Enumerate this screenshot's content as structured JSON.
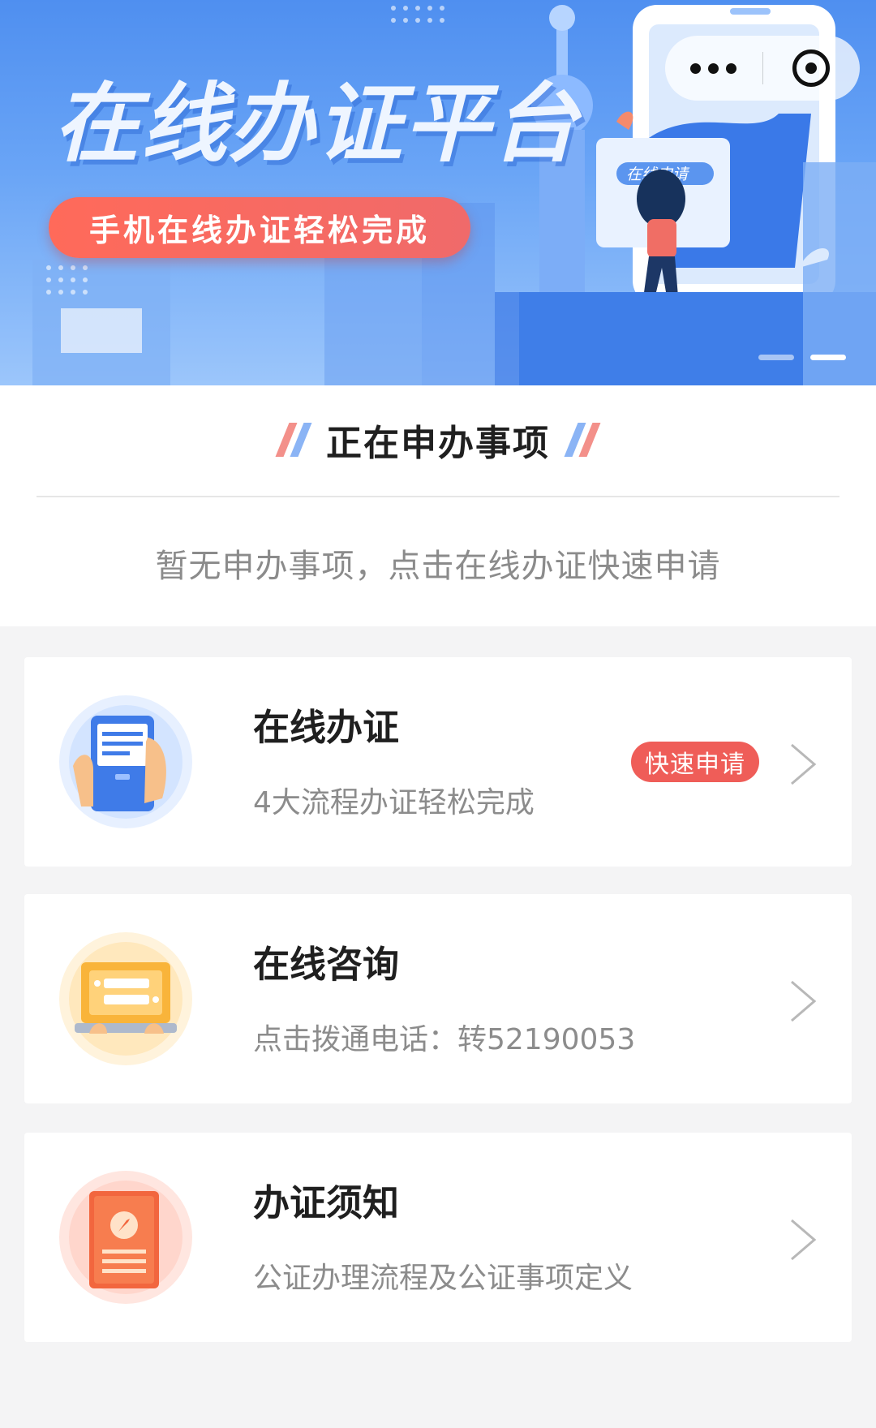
{
  "banner": {
    "title": "在线办证平台",
    "slogan": "手机在线办证轻松完成",
    "illustration_label": "在线申请",
    "carousel": {
      "count": 2,
      "active": 2
    },
    "capsule": {
      "more_icon": "more-dots-icon",
      "close_icon": "target-close-icon"
    }
  },
  "current": {
    "title": "正在申办事项",
    "empty_message": "暂无申办事项，点击在线办证快速申请"
  },
  "cards": [
    {
      "title": "在线办证",
      "subtitle": "4大流程办证轻松完成",
      "badge": "快速申请",
      "icon": "phone-hand-icon"
    },
    {
      "title": "在线咨询",
      "subtitle": "点击拨通电话：转52190053",
      "icon": "laptop-chat-icon"
    },
    {
      "title": "办证须知",
      "subtitle": "公证办理流程及公证事项定义",
      "icon": "document-compass-icon"
    }
  ],
  "colors": {
    "banner_blue": "#4f8ff0",
    "accent_red": "#ef5d58",
    "text_dark": "#1f1f1f",
    "text_gray": "#8c8c8c"
  }
}
